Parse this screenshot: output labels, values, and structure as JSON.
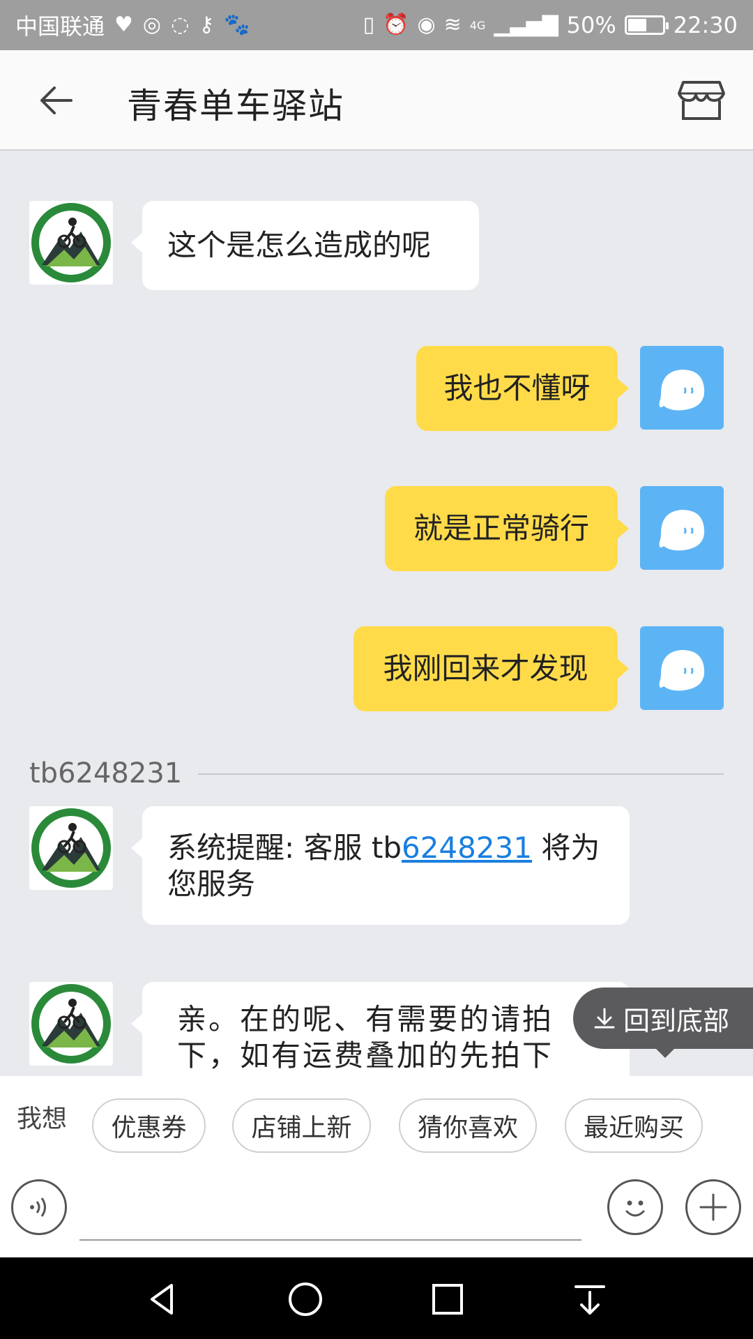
{
  "status_bar": {
    "carrier": "中国联通",
    "network": "4G",
    "battery": "50%",
    "battery_level": 0.5,
    "time": "22:30"
  },
  "header": {
    "title": "青春单车驿站"
  },
  "messages": [
    {
      "side": "in",
      "text": "这个是怎么造成的呢"
    },
    {
      "side": "out",
      "text": "我也不懂呀"
    },
    {
      "side": "out",
      "text": "就是正常骑行"
    },
    {
      "side": "out",
      "text": "我刚回来才发现"
    }
  ],
  "divider": {
    "name": "tb6248231"
  },
  "system_message": {
    "prefix": "系统提醒: 客服 tb",
    "link": "6248231",
    "suffix": " 将为您服务"
  },
  "last_message": {
    "text": "亲。在的呢、有需要的请拍下，如有运费叠加的先拍下"
  },
  "to_bottom": {
    "label": "回到底部"
  },
  "quick_bar": {
    "label": "我想",
    "chips": [
      "优惠券",
      "店铺上新",
      "猜你喜欢",
      "最近购买"
    ]
  },
  "colors": {
    "outgoing_bubble": "#ffdb4a",
    "incoming_bubble": "#ffffff",
    "my_avatar": "#5cb4f5",
    "link": "#1a7fe0",
    "chat_background": "#e9eaee"
  }
}
